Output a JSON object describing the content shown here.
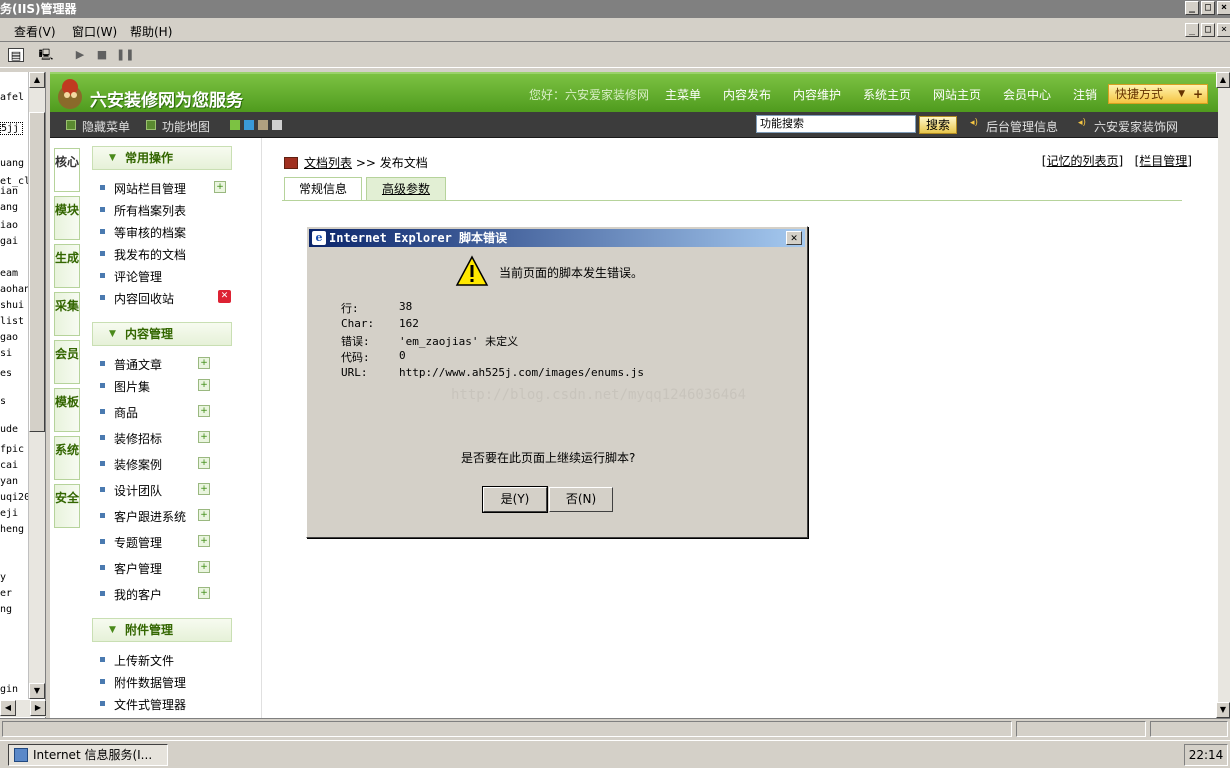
{
  "window": {
    "title": "务(IIS)管理器",
    "min": "_",
    "max": "□",
    "close": "×"
  },
  "menubar": {
    "items": [
      "查看(V)",
      "窗口(W)",
      "帮助(H)"
    ]
  },
  "tree": {
    "items": [
      "afel",
      "5jj",
      "uang",
      "et_cl",
      "ian",
      "ang",
      "iao",
      "gai",
      "eam",
      "aohan",
      "shui",
      "list",
      "gao",
      "si",
      "es",
      "s",
      "ude",
      "fpic",
      "cai",
      "yan",
      "uqi20",
      "eji",
      "heng",
      "y",
      "er",
      "ng",
      "gin"
    ]
  },
  "header": {
    "logo": "六安装修网为您服务",
    "greeting": "您好：六安爱家装修网",
    "nav": [
      "主菜单",
      "内容发布",
      "内容维护",
      "系统主页",
      "网站主页",
      "会员中心",
      "注销"
    ],
    "quick": "快捷方式"
  },
  "subbar": {
    "hide_menu": "隐藏菜单",
    "func_map": "功能地图",
    "search_value": "功能搜索",
    "search_btn": "搜索",
    "backend": "后台管理信息",
    "site": "六安爱家装饰网"
  },
  "categories": [
    "核心",
    "模块",
    "生成",
    "采集",
    "会员",
    "模板",
    "系统",
    "安全"
  ],
  "menu": {
    "groups": [
      "常用操作",
      "内容管理",
      "附件管理"
    ],
    "common": [
      "网站栏目管理",
      "所有档案列表",
      "等审核的档案",
      "我发布的文档",
      "评论管理",
      "内容回收站"
    ],
    "content": [
      "普通文章",
      "图片集",
      "商品",
      "装修招标",
      "装修案例",
      "设计团队",
      "客户跟进系统",
      "专题管理",
      "客户管理",
      "我的客户"
    ],
    "attach": [
      "上传新文件",
      "附件数据管理",
      "文件式管理器"
    ]
  },
  "main": {
    "breadcrumb_link": "文档列表",
    "breadcrumb_sep": ">>",
    "breadcrumb_current": "发布文档",
    "link_remember": "[记忆的列表页]",
    "link_column": "[栏目管理]",
    "tab_general": "常规信息",
    "tab_advanced": "高级参数"
  },
  "dialog": {
    "title": "Internet Explorer 脚本错误",
    "message": "当前页面的脚本发生错误。",
    "rows": [
      {
        "k": "行:",
        "v": "38"
      },
      {
        "k": "Char:",
        "v": "162"
      },
      {
        "k": "错误:",
        "v": "'em_zaojias' 未定义"
      },
      {
        "k": "代码:",
        "v": "0"
      },
      {
        "k": "URL:",
        "v": "http://www.ah525j.com/images/enums.js"
      }
    ],
    "watermark": "http://blog.csdn.net/myqq1246036464",
    "question": "是否要在此页面上继续运行脚本?",
    "yes": "是(Y)",
    "no": "否(N)"
  },
  "taskbar": {
    "task": "Internet 信息服务(I...",
    "clock": "22:14"
  },
  "colors": {
    "green_header": "#5fae2a",
    "dark_bar": "#3c3c3c",
    "dialog_title": "#0a246a"
  }
}
